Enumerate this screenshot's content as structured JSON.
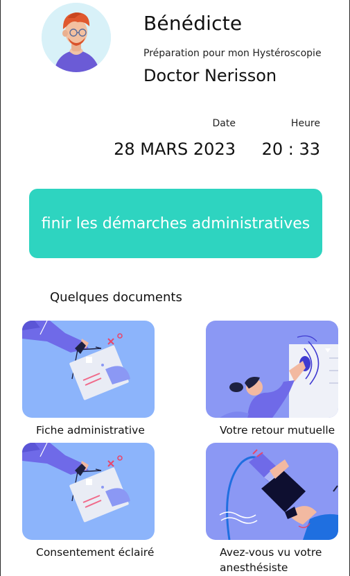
{
  "profile": {
    "name": "Bénédicte",
    "procedure": "Préparation pour mon Hystéroscopie",
    "doctor": "Doctor Nerisson",
    "avatar_icon": "user-avatar"
  },
  "appointment": {
    "date_label": "Date",
    "time_label": "Heure",
    "date_value": "28 MARS 2023",
    "time_value": "20 : 33"
  },
  "cta": {
    "label": "finir les démarches administratives",
    "color": "#2ed4c0"
  },
  "documents": {
    "title": "Quelques documents",
    "items": [
      {
        "label": "Fiche administrative",
        "icon": "form-document-illustration"
      },
      {
        "label": "Votre retour mutuelle",
        "icon": "woman-tapping-screen-illustration"
      },
      {
        "label": "Consentement éclairé",
        "icon": "form-document-illustration"
      },
      {
        "label": "Avez-vous vu votre anesthésiste",
        "icon": "oxygen-mask-illustration"
      }
    ]
  },
  "colors": {
    "accent": "#2ed4c0",
    "thumb_light_blue": "#8cb4fb",
    "thumb_periwinkle": "#8b98f4"
  }
}
